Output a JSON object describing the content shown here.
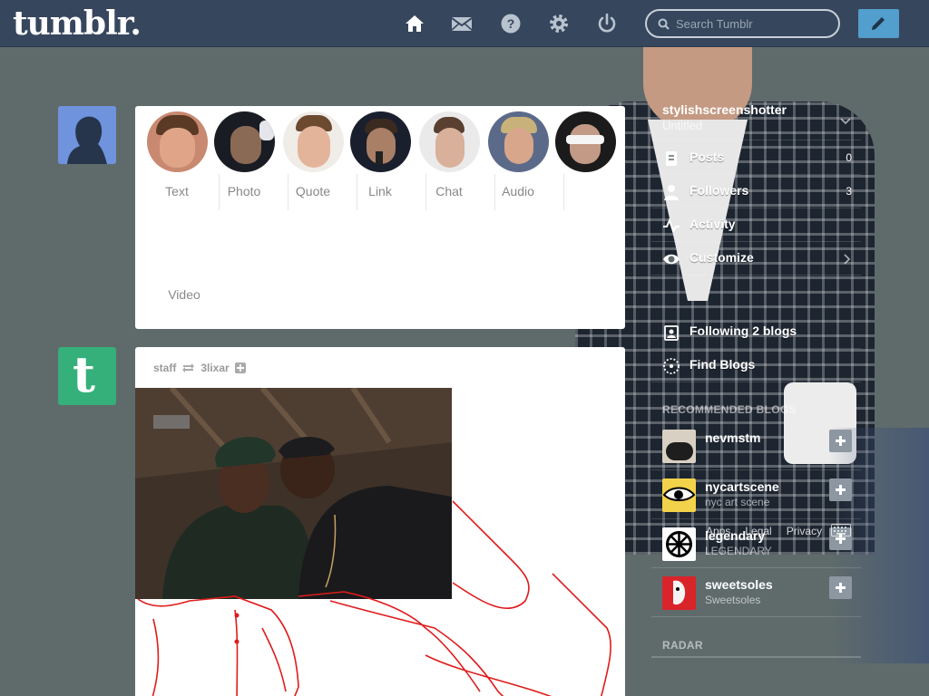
{
  "header": {
    "logo": "tumblr.",
    "nav": [
      "home-icon",
      "mail-icon",
      "help-icon",
      "settings-icon",
      "power-icon"
    ],
    "search_placeholder": "Search Tumblr",
    "compose_icon": "pencil-icon"
  },
  "post_types": [
    {
      "label": "Text"
    },
    {
      "label": "Photo"
    },
    {
      "label": "Quote"
    },
    {
      "label": "Link"
    },
    {
      "label": "Chat"
    },
    {
      "label": "Audio"
    },
    {
      "label": "Video"
    }
  ],
  "post": {
    "reblogged_from": "staff",
    "reblog_icon": "reblog-icon",
    "author": "3lixar",
    "follow_icon": "plus-icon"
  },
  "sidebar": {
    "blog_name": "stylishscreenshotter",
    "blog_title": "Untitled",
    "items": [
      {
        "label": "Posts",
        "count": "0",
        "icon": "document-icon"
      },
      {
        "label": "Followers",
        "count": "3",
        "icon": "person-icon"
      },
      {
        "label": "Activity",
        "count": "",
        "icon": "activity-icon"
      },
      {
        "label": "Customize",
        "count": "",
        "icon": "eye-icon"
      }
    ],
    "following": "Following 2 blogs",
    "find_blogs": "Find Blogs",
    "recommended_title": "RECOMMENDED BLOGS",
    "recommended": [
      {
        "name": "nevmstm",
        "sub": ""
      },
      {
        "name": "nycartscene",
        "sub": "nyc art scene"
      },
      {
        "name": "legendary",
        "sub": "LEGENDARY"
      },
      {
        "name": "sweetsoles",
        "sub": "Sweetsoles"
      }
    ],
    "radar_title": "RADAR",
    "footer_links": [
      "Apps",
      "Legal",
      "Privacy"
    ]
  },
  "colors": {
    "header_bg": "#36465d",
    "page_bg": "#5f6b6b",
    "compose_bg": "#529ecc",
    "staff_avatar": "#35b07a"
  }
}
